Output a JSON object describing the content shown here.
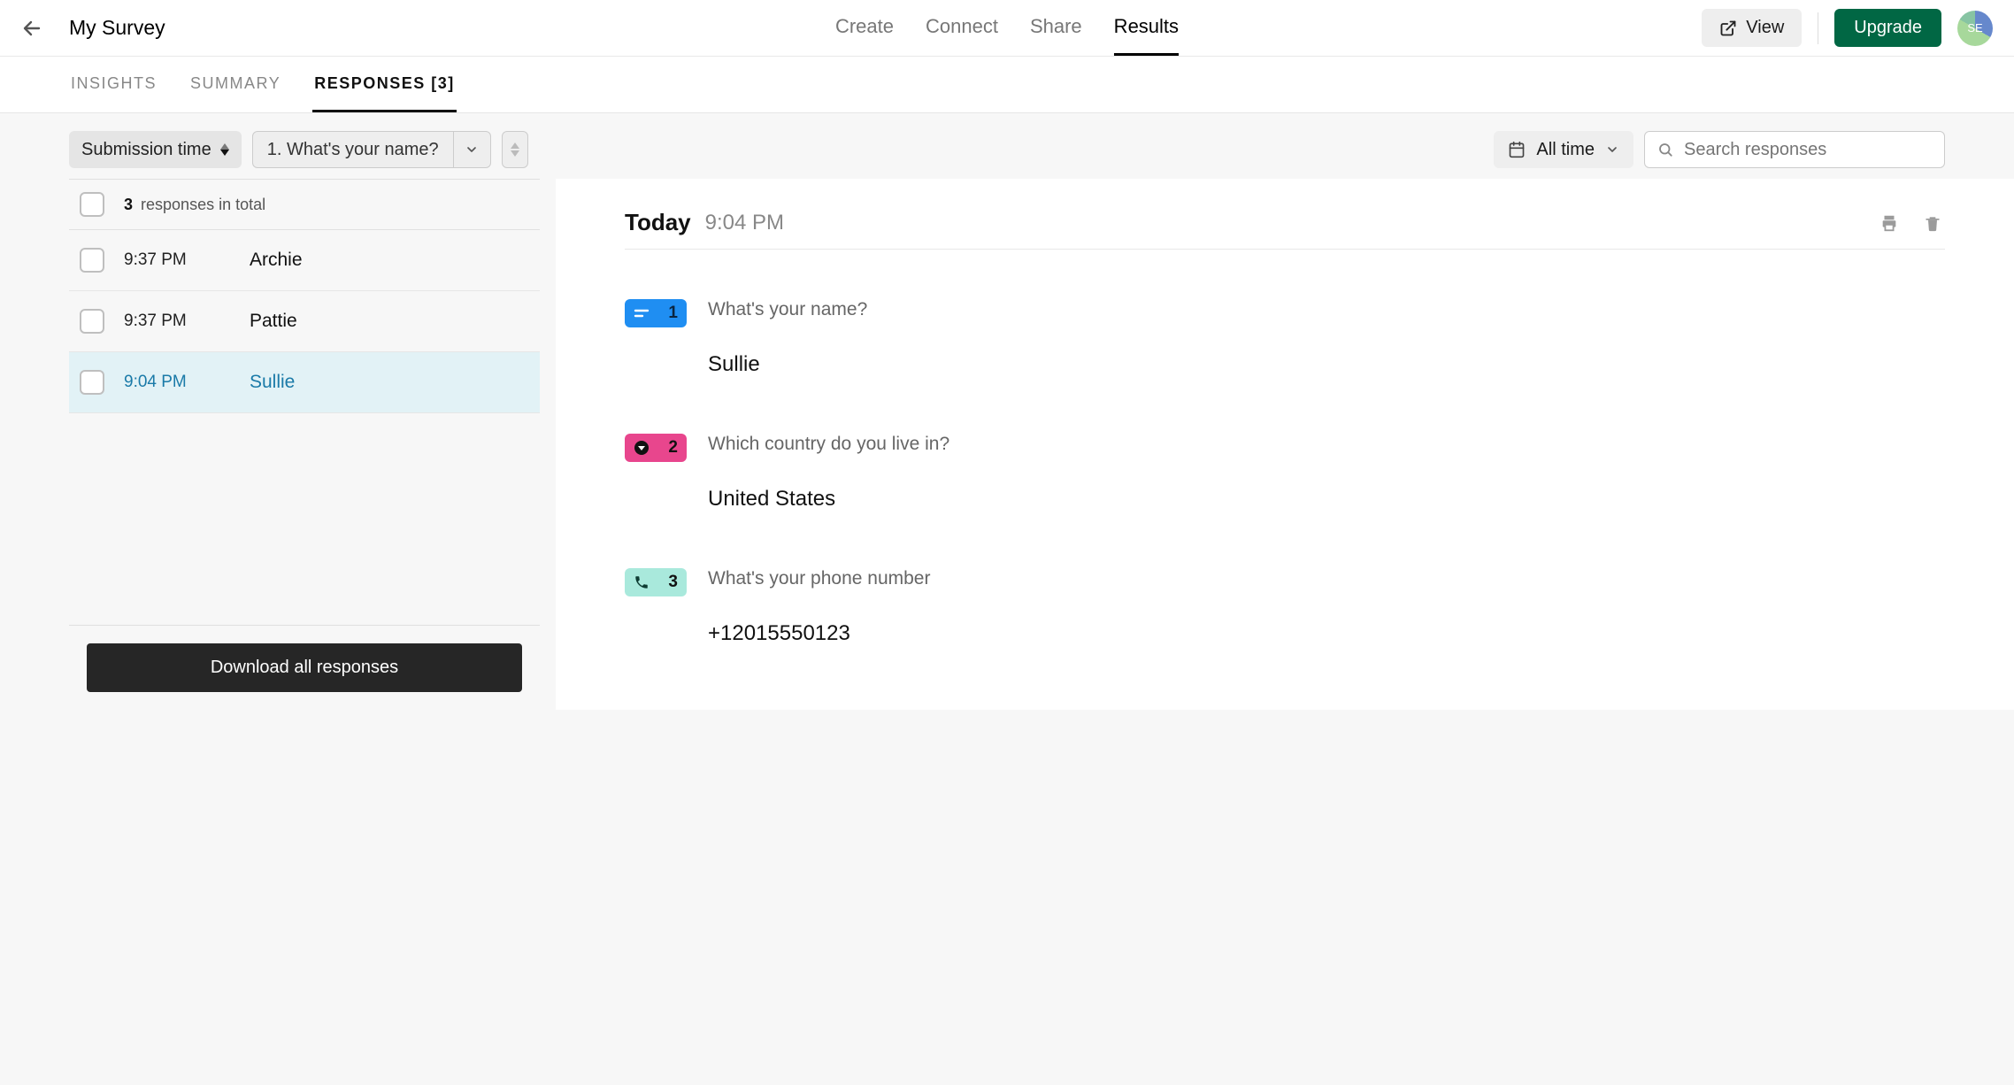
{
  "header": {
    "title": "My Survey",
    "tabs": [
      "Create",
      "Connect",
      "Share",
      "Results"
    ],
    "active_tab": "Results",
    "view_label": "View",
    "upgrade_label": "Upgrade",
    "avatar_initials": "SE"
  },
  "subtabs": {
    "items": [
      "Insights",
      "Summary",
      "Responses [3]"
    ],
    "active": "Responses [3]"
  },
  "filters": {
    "sort_label": "Submission time",
    "question_label": "1. What's your name?",
    "date_label": "All time",
    "search_placeholder": "Search responses"
  },
  "list": {
    "total_count": "3",
    "total_suffix": "responses in total",
    "rows": [
      {
        "time": "9:37 PM",
        "name": "Archie",
        "active": false
      },
      {
        "time": "9:37 PM",
        "name": "Pattie",
        "active": false
      },
      {
        "time": "9:04 PM",
        "name": "Sullie",
        "active": true
      }
    ],
    "download_label": "Download all responses"
  },
  "detail": {
    "today_label": "Today",
    "time_label": "9:04 PM",
    "questions": [
      {
        "num": "1",
        "type": "text",
        "question": "What's your name?",
        "answer": "Sullie"
      },
      {
        "num": "2",
        "type": "dropdown",
        "question": "Which country do you live in?",
        "answer": "United States"
      },
      {
        "num": "3",
        "type": "phone",
        "question": "What's your phone number",
        "answer": "+12015550123"
      }
    ]
  }
}
